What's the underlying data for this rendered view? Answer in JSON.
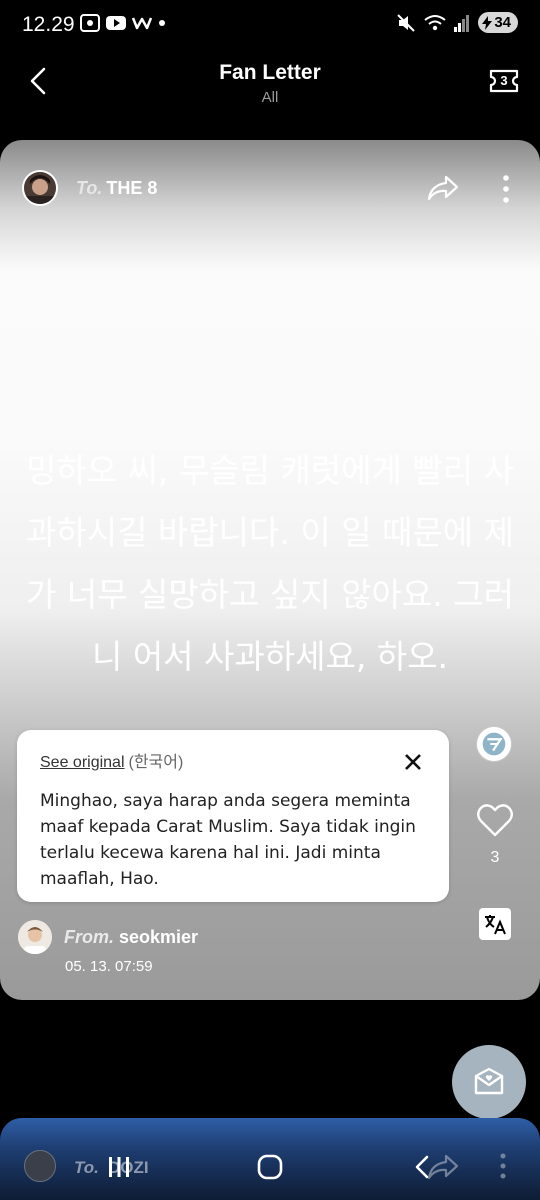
{
  "status_bar": {
    "time": "12.29",
    "battery": "34"
  },
  "header": {
    "title": "Fan Letter",
    "subtitle": "All",
    "ticket_count": "3"
  },
  "letter": {
    "to_label": "To.",
    "to_name": "THE 8",
    "original_text": "밍하오 씨, 무슬림 캐럿에게 빨리 사과하시길 바랍니다. 이 일 때문에 제가 너무 실망하고 싶지 않아요. 그러니 어서 사과하세요, 하오.",
    "translation": {
      "see_original": "See original",
      "language": "(한국어)",
      "text": "Minghao, saya harap anda segera meminta maaf kepada Carat Muslim. Saya tidak ingin terlalu kecewa karena hal ini. Jadi minta maaflah, Hao."
    },
    "like_count": "3",
    "from_label": "From.",
    "from_name": "seokmier",
    "date": "05. 13. 07:59"
  },
  "next_letter": {
    "to_label": "To.",
    "to_name": "DOZI"
  },
  "icons": {
    "back": "chevron-left-icon",
    "ticket": "ticket-icon",
    "share": "share-icon",
    "more": "more-vertical-icon",
    "close": "close-icon",
    "like": "heart-icon",
    "translate": "translate-icon",
    "artist_badge": "seventeen-logo-icon",
    "fab": "letterbox-icon"
  }
}
